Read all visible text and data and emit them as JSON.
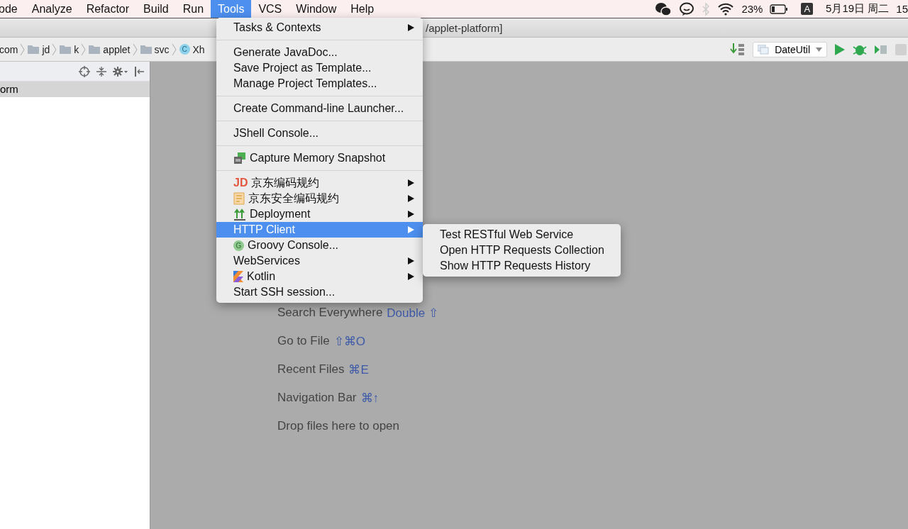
{
  "menu_bar": {
    "items": [
      {
        "label": "ode",
        "selected": false
      },
      {
        "label": "Analyze",
        "selected": false
      },
      {
        "label": "Refactor",
        "selected": false
      },
      {
        "label": "Build",
        "selected": false
      },
      {
        "label": "Run",
        "selected": false
      },
      {
        "label": "Tools",
        "selected": true
      },
      {
        "label": "VCS",
        "selected": false
      },
      {
        "label": "Window",
        "selected": false
      },
      {
        "label": "Help",
        "selected": false
      }
    ],
    "status": {
      "battery_text": "23%",
      "input_source": "A",
      "date": "5月19日 周二",
      "time": "15"
    }
  },
  "window": {
    "title": "/applet-platform]"
  },
  "breadcrumbs": [
    {
      "label": "com",
      "kind": "text"
    },
    {
      "label": "jd",
      "kind": "folder"
    },
    {
      "label": "k",
      "kind": "folder"
    },
    {
      "label": "applet",
      "kind": "folder"
    },
    {
      "label": "svc",
      "kind": "folder"
    },
    {
      "label": "Xh",
      "kind": "class",
      "badge": "C"
    }
  ],
  "run_config": {
    "label": "DateUtil"
  },
  "project_panel": {
    "rows": [
      {
        "label": "orm",
        "selected": true
      }
    ]
  },
  "welcome": [
    {
      "text": "Search Everywhere",
      "shortcut": "Double ⇧"
    },
    {
      "text": "Go to File",
      "shortcut": "⇧⌘O"
    },
    {
      "text": "Recent Files",
      "shortcut": "⌘E"
    },
    {
      "text": "Navigation Bar",
      "shortcut": "⌘↑"
    },
    {
      "text": "Drop files here to open"
    }
  ],
  "tools_menu": {
    "items": [
      {
        "kind": "item",
        "label": "Tasks & Contexts",
        "submenu": true,
        "selected": false
      },
      {
        "kind": "separator"
      },
      {
        "kind": "item",
        "label": "Generate JavaDoc...",
        "submenu": false,
        "selected": false
      },
      {
        "kind": "item",
        "label": "Save Project as Template...",
        "submenu": false,
        "selected": false
      },
      {
        "kind": "item",
        "label": "Manage Project Templates...",
        "submenu": false,
        "selected": false
      },
      {
        "kind": "separator"
      },
      {
        "kind": "item",
        "label": "Create Command-line Launcher...",
        "submenu": false,
        "selected": false
      },
      {
        "kind": "separator"
      },
      {
        "kind": "item",
        "label": "JShell Console...",
        "submenu": false,
        "selected": false
      },
      {
        "kind": "separator"
      },
      {
        "kind": "snapshot",
        "label": "Capture Memory Snapshot",
        "submenu": false,
        "selected": false
      },
      {
        "kind": "separator"
      },
      {
        "kind": "jd",
        "label": "京东编码规约",
        "badge": "JD",
        "submenu": true,
        "selected": false
      },
      {
        "kind": "document",
        "label": "京东安全编码规约",
        "submenu": true,
        "selected": false
      },
      {
        "kind": "deploy",
        "label": "Deployment",
        "submenu": true,
        "selected": false
      },
      {
        "kind": "item",
        "label": "HTTP Client",
        "submenu": true,
        "selected": true
      },
      {
        "kind": "groovy",
        "label": "Groovy Console...",
        "badge": "G",
        "submenu": false,
        "selected": false
      },
      {
        "kind": "item",
        "label": "WebServices",
        "submenu": true,
        "selected": false
      },
      {
        "kind": "kotlin",
        "label": "Kotlin",
        "submenu": true,
        "selected": false
      },
      {
        "kind": "item",
        "label": "Start SSH session...",
        "submenu": false,
        "selected": false
      }
    ]
  },
  "http_client_submenu": {
    "items": [
      {
        "label": "Test RESTful Web Service",
        "selected": false
      },
      {
        "label": "Open HTTP Requests Collection",
        "selected": false
      },
      {
        "label": "Show HTTP Requests History",
        "selected": false
      }
    ]
  }
}
